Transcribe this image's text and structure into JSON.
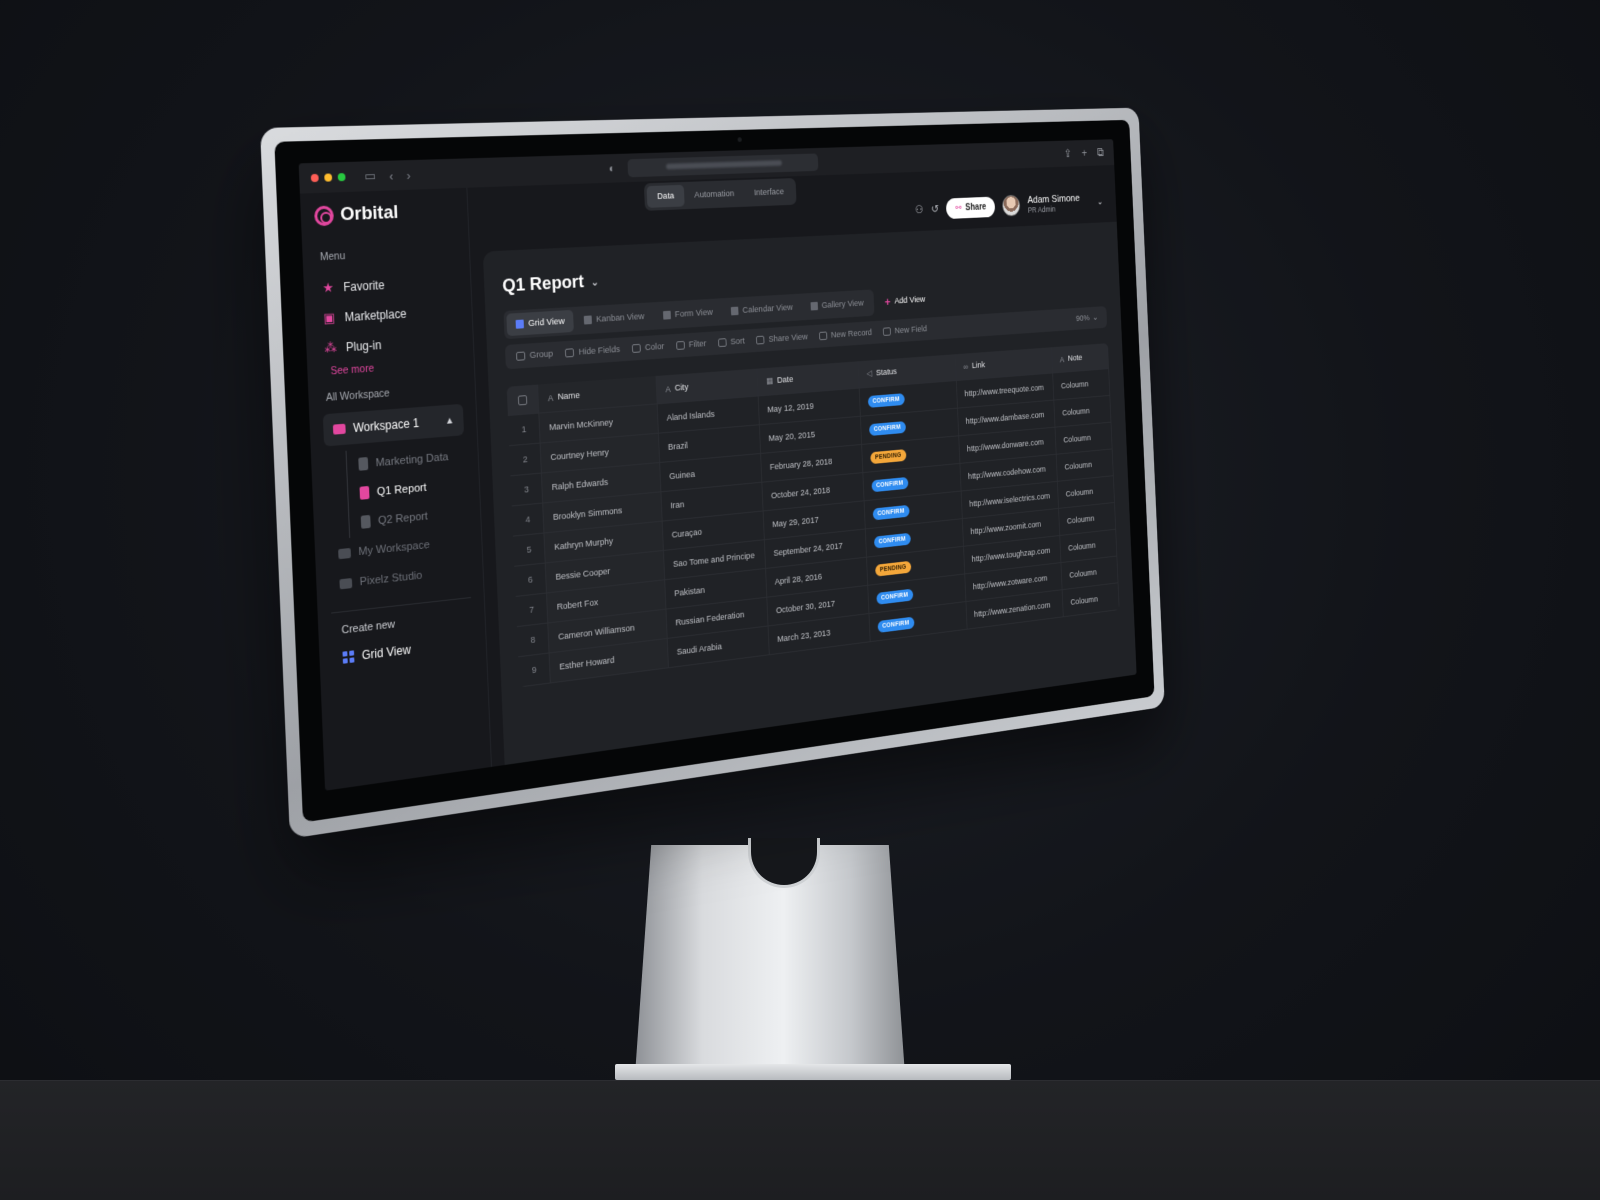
{
  "app": {
    "name": "Orbital"
  },
  "browser": {
    "url": "Orbital.com/2/Report/Report"
  },
  "mode_tabs": [
    {
      "label": "Data",
      "active": true
    },
    {
      "label": "Automation",
      "active": false
    },
    {
      "label": "Interface",
      "active": false
    }
  ],
  "user": {
    "name": "Adam Simone",
    "role": "PR Admin"
  },
  "share_label": "Share",
  "sidebar": {
    "menu_label": "Menu",
    "items": [
      {
        "label": "Favorite",
        "icon": "star-icon"
      },
      {
        "label": "Marketplace",
        "icon": "bag-icon"
      },
      {
        "label": "Plug-in",
        "icon": "plugin-icon"
      }
    ],
    "see_more": "See more",
    "all_workspace_label": "All Workspace",
    "workspace_active": "Workspace 1",
    "workspace_children": [
      {
        "label": "Marketing Data",
        "active": false
      },
      {
        "label": "Q1 Report",
        "active": true
      },
      {
        "label": "Q2 Report",
        "active": false
      }
    ],
    "other_workspaces": [
      "My Workspace",
      "Pixelz Studio"
    ],
    "create_new_label": "Create new",
    "create_new_item": "Grid View"
  },
  "page": {
    "title": "Q1 Report"
  },
  "views": [
    {
      "label": "Grid View",
      "active": true
    },
    {
      "label": "Kanban View",
      "active": false
    },
    {
      "label": "Form View",
      "active": false
    },
    {
      "label": "Calendar View",
      "active": false
    },
    {
      "label": "Gallery View",
      "active": false
    }
  ],
  "add_view": "Add View",
  "toolbar": [
    "Group",
    "Hide Fields",
    "Color",
    "Filter",
    "Sort",
    "Share View",
    "New Record",
    "New Field"
  ],
  "zoom": "90%",
  "table": {
    "columns": [
      "Name",
      "City",
      "Date",
      "Status",
      "Link",
      "Note"
    ],
    "rows": [
      {
        "idx": "1",
        "name": "Marvin McKinney",
        "city": "Aland Islands",
        "date": "May 12, 2019",
        "status": "CONFIRM",
        "link": "http://www.treequote.com",
        "note": "Coloumn"
      },
      {
        "idx": "2",
        "name": "Courtney Henry",
        "city": "Brazil",
        "date": "May 20, 2015",
        "status": "CONFIRM",
        "link": "http://www.dambase.com",
        "note": "Coloumn"
      },
      {
        "idx": "3",
        "name": "Ralph Edwards",
        "city": "Guinea",
        "date": "February 28, 2018",
        "status": "PENDING",
        "link": "http://www.donware.com",
        "note": "Coloumn"
      },
      {
        "idx": "4",
        "name": "Brooklyn Simmons",
        "city": "Iran",
        "date": "October 24, 2018",
        "status": "CONFIRM",
        "link": "http://www.codehow.com",
        "note": "Coloumn"
      },
      {
        "idx": "5",
        "name": "Kathryn Murphy",
        "city": "Curaçao",
        "date": "May 29, 2017",
        "status": "CONFIRM",
        "link": "http://www.iselectrics.com",
        "note": "Coloumn"
      },
      {
        "idx": "6",
        "name": "Bessie Cooper",
        "city": "Sao Tome and Principe",
        "date": "September 24, 2017",
        "status": "CONFIRM",
        "link": "http://www.zoomit.com",
        "note": "Coloumn"
      },
      {
        "idx": "7",
        "name": "Robert Fox",
        "city": "Pakistan",
        "date": "April 28, 2016",
        "status": "PENDING",
        "link": "http://www.toughzap.com",
        "note": "Coloumn"
      },
      {
        "idx": "8",
        "name": "Cameron Williamson",
        "city": "Russian Federation",
        "date": "October 30, 2017",
        "status": "CONFIRM",
        "link": "http://www.zotware.com",
        "note": "Coloumn"
      },
      {
        "idx": "9",
        "name": "Esther Howard",
        "city": "Saudi Arabia",
        "date": "March 23, 2013",
        "status": "CONFIRM",
        "link": "http://www.zenation.com",
        "note": "Coloumn"
      }
    ]
  },
  "colors": {
    "accent": "#e2479f",
    "confirm": "#2f8cf0",
    "pending": "#f4a73a",
    "grid_icon": "#5b7cf7"
  }
}
